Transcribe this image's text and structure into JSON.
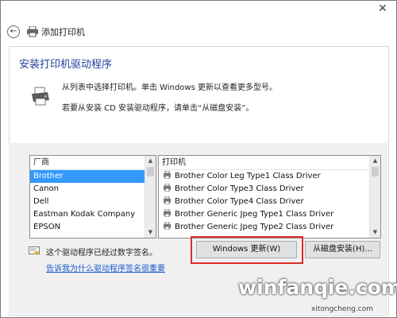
{
  "window": {
    "title": "添加打印机",
    "close_glyph": "✕"
  },
  "page": {
    "title": "安装打印机驱动程序",
    "instruction_1": "从列表中选择打印机。单击 Windows 更新以查看更多型号。",
    "instruction_2": "若要从安装 CD 安装驱动程序，请单击“从磁盘安装”。"
  },
  "manufacturers": {
    "header": "厂商",
    "items": [
      "Brother",
      "Canon",
      "Dell",
      "Eastman Kodak Company",
      "EPSON"
    ],
    "selected": "Brother"
  },
  "printers": {
    "header": "打印机",
    "items": [
      "Brother Color Leg Type1 Class Driver",
      "Brother Color Type3 Class Driver",
      "Brother Color Type4 Class Driver",
      "Brother Generic Jpeg Type1 Class Driver",
      "Brother Generic Jpeg Type2 Class Driver"
    ]
  },
  "footer": {
    "signed_text": "这个驱动程序已经过数字签名。",
    "link_text": "告诉我为什么驱动程序签名很重要",
    "windows_update_label": "Windows 更新(W)",
    "have_disk_label": "从磁盘安装(H)..."
  },
  "watermark": {
    "text": "winfanqie.com",
    "sub": "xitongcheng.com"
  },
  "icons": {
    "back": "back-arrow-icon",
    "printer": "printer-icon",
    "driver": "printer-driver-icon",
    "certificate": "certificate-icon"
  },
  "colors": {
    "accent_title": "#1e3f9a",
    "selection": "#3399ff",
    "link": "#1a5bd0",
    "highlight_box": "#e02b2b"
  }
}
